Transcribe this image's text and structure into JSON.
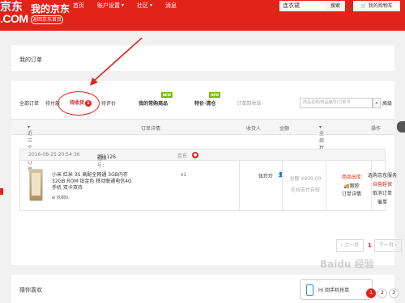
{
  "topbar": {
    "logo_left": "京东",
    "logo_com": ".COM",
    "title": "我的京东",
    "back_home": "返回京东首页",
    "nav": [
      {
        "label": "首页",
        "has_chevron": false
      },
      {
        "label": "账户设置",
        "has_chevron": true
      },
      {
        "label": "社区",
        "has_chevron": true
      },
      {
        "label": "消息",
        "has_chevron": false
      }
    ],
    "search_value": "连衣裙",
    "search_button": "搜索",
    "cart_button": "我的购物车",
    "accent": "#e2231a"
  },
  "header_panel": {
    "title": "我的订单"
  },
  "tabs": [
    {
      "label": "全部订单"
    },
    {
      "label": "待付款"
    },
    {
      "label": "待收货",
      "badge": "1"
    },
    {
      "label": "待评价"
    },
    {
      "label": "我的常购商品",
      "new": "NEW"
    },
    {
      "label": "特价·清仓",
      "new": "NEW"
    },
    {
      "label": "订单回收站"
    }
  ],
  "order_search": {
    "placeholder": "商品名称/商品编号/订单号",
    "advanced": "高级"
  },
  "table_header": {
    "range": "近三个月订单",
    "detail": "订单详情",
    "receiver": "收货人",
    "amount": "金额",
    "status": "全部状态",
    "action": "操作"
  },
  "order": {
    "date": "2016-08-25 20:54:36",
    "order_no_label": "订单号：",
    "order_no": "201126",
    "order_no_tail": "25",
    "shop": "京东",
    "product_name": "小米 红米 3S 高配全网通 3GB内存 32GB ROM 铂金色 移动联通电信4G手机 双卡双待",
    "find_similar": "找相似",
    "quantity": "x1",
    "receiver": "伍玲玲",
    "amount": "总额 ¥899.00",
    "pay_method": "在线支付自取",
    "status_main": "商品出库",
    "status_track": "跟踪",
    "status_detail": "订单详情",
    "ops": [
      "选购京东服务",
      "自营延保",
      "取消订单",
      "催单"
    ]
  },
  "pager": {
    "prev": "上一页",
    "current": "1",
    "next": "下一页"
  },
  "bottom": {
    "title": "猜你喜欢",
    "mobile_order": "Hi 回手机抢单",
    "pages": [
      "1",
      "2",
      "3"
    ]
  },
  "watermark": "Baidu 经验"
}
